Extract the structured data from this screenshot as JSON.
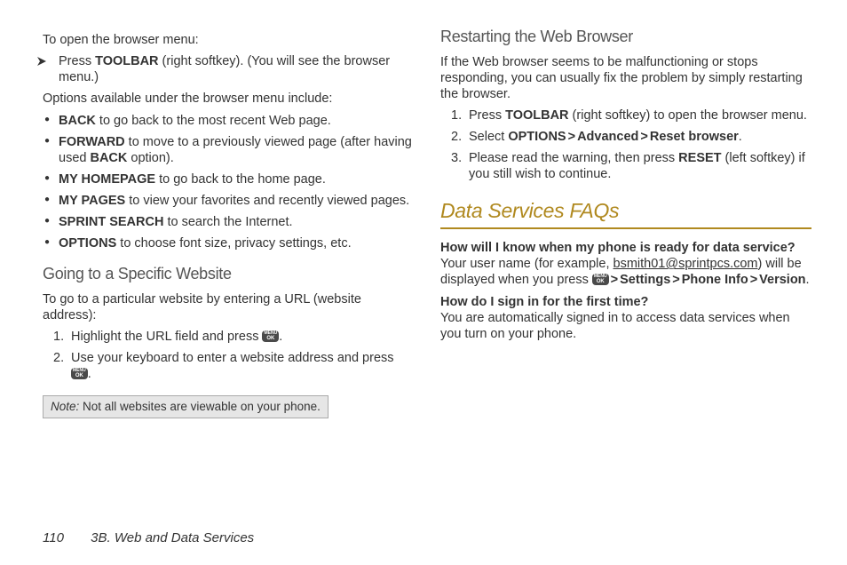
{
  "left": {
    "intro": "To open the browser menu:",
    "arrow_item_pre": "Press ",
    "arrow_item_b": "TOOLBAR",
    "arrow_item_post": " (right softkey). (You will see the browser menu.)",
    "options_intro": "Options available under the browser menu include:",
    "items": [
      {
        "b": "BACK",
        "t": " to go back to the most recent Web page."
      },
      {
        "b": "FORWARD",
        "t": " to move to a previously viewed page (after having used ",
        "b2": "BACK",
        "t2": " option)."
      },
      {
        "b": "MY HOMEPAGE",
        "t": " to go back to the home page."
      },
      {
        "b": "MY PAGES",
        "t": " to view your favorites and recently viewed pages."
      },
      {
        "b": "SPRINT SEARCH",
        "t": " to search the Internet."
      },
      {
        "b": "OPTIONS",
        "t": " to choose font size, privacy settings, etc."
      }
    ],
    "going_head": "Going to a Specific Website",
    "going_intro": "To go to a particular website by entering a URL (website address):",
    "steps": [
      {
        "n": "1.",
        "t1": "Highlight the URL field and press ",
        "key": true,
        "t2": "."
      },
      {
        "n": "2.",
        "t1": "Use your keyboard to enter a website address and press ",
        "key": true,
        "t2": "."
      }
    ],
    "note_label": "Note:  ",
    "note_text": "Not all websites are viewable on your phone."
  },
  "right": {
    "restart_head": "Restarting the Web Browser",
    "restart_intro": "If the Web browser seems to be malfunctioning or stops responding, you can usually fix the problem by simply restarting the browser.",
    "rsteps": {
      "s1_pre": "Press ",
      "s1_b": "TOOLBAR",
      "s1_post": " (right softkey) to open the browser menu.",
      "s2_pre": "Select ",
      "s2_b1": "OPTIONS",
      "s2_b2": "Advanced",
      "s2_b3": "Reset browser",
      "s3_pre": "Please read the warning, then press ",
      "s3_b": "RESET",
      "s3_post": " (left softkey) if you still wish to continue."
    },
    "faq_head": "Data Services FAQs",
    "q1": "How will I know when my phone is ready for data service?",
    "a1_pre": "Your user name (for example, ",
    "a1_link": "bsmith01@sprintpcs.com",
    "a1_mid": ") will be displayed when you press ",
    "a1_b1": "Settings",
    "a1_b2": "Phone Info",
    "a1_b3": "Version",
    "q2": "How do I sign in for the first time?",
    "a2": "You are automatically signed in to access data services when you turn on your phone."
  },
  "footer_page": "110",
  "footer_sec": "3B. Web and Data Services",
  "gt": ">",
  "dot": "."
}
